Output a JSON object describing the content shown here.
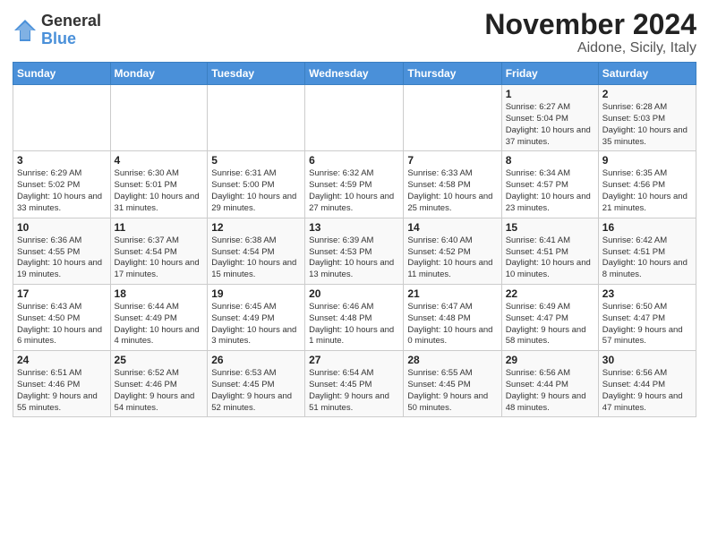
{
  "header": {
    "logo_general": "General",
    "logo_blue": "Blue",
    "title": "November 2024",
    "subtitle": "Aidone, Sicily, Italy"
  },
  "days_of_week": [
    "Sunday",
    "Monday",
    "Tuesday",
    "Wednesday",
    "Thursday",
    "Friday",
    "Saturday"
  ],
  "weeks": [
    [
      {
        "day": "",
        "info": ""
      },
      {
        "day": "",
        "info": ""
      },
      {
        "day": "",
        "info": ""
      },
      {
        "day": "",
        "info": ""
      },
      {
        "day": "",
        "info": ""
      },
      {
        "day": "1",
        "info": "Sunrise: 6:27 AM\nSunset: 5:04 PM\nDaylight: 10 hours and 37 minutes."
      },
      {
        "day": "2",
        "info": "Sunrise: 6:28 AM\nSunset: 5:03 PM\nDaylight: 10 hours and 35 minutes."
      }
    ],
    [
      {
        "day": "3",
        "info": "Sunrise: 6:29 AM\nSunset: 5:02 PM\nDaylight: 10 hours and 33 minutes."
      },
      {
        "day": "4",
        "info": "Sunrise: 6:30 AM\nSunset: 5:01 PM\nDaylight: 10 hours and 31 minutes."
      },
      {
        "day": "5",
        "info": "Sunrise: 6:31 AM\nSunset: 5:00 PM\nDaylight: 10 hours and 29 minutes."
      },
      {
        "day": "6",
        "info": "Sunrise: 6:32 AM\nSunset: 4:59 PM\nDaylight: 10 hours and 27 minutes."
      },
      {
        "day": "7",
        "info": "Sunrise: 6:33 AM\nSunset: 4:58 PM\nDaylight: 10 hours and 25 minutes."
      },
      {
        "day": "8",
        "info": "Sunrise: 6:34 AM\nSunset: 4:57 PM\nDaylight: 10 hours and 23 minutes."
      },
      {
        "day": "9",
        "info": "Sunrise: 6:35 AM\nSunset: 4:56 PM\nDaylight: 10 hours and 21 minutes."
      }
    ],
    [
      {
        "day": "10",
        "info": "Sunrise: 6:36 AM\nSunset: 4:55 PM\nDaylight: 10 hours and 19 minutes."
      },
      {
        "day": "11",
        "info": "Sunrise: 6:37 AM\nSunset: 4:54 PM\nDaylight: 10 hours and 17 minutes."
      },
      {
        "day": "12",
        "info": "Sunrise: 6:38 AM\nSunset: 4:54 PM\nDaylight: 10 hours and 15 minutes."
      },
      {
        "day": "13",
        "info": "Sunrise: 6:39 AM\nSunset: 4:53 PM\nDaylight: 10 hours and 13 minutes."
      },
      {
        "day": "14",
        "info": "Sunrise: 6:40 AM\nSunset: 4:52 PM\nDaylight: 10 hours and 11 minutes."
      },
      {
        "day": "15",
        "info": "Sunrise: 6:41 AM\nSunset: 4:51 PM\nDaylight: 10 hours and 10 minutes."
      },
      {
        "day": "16",
        "info": "Sunrise: 6:42 AM\nSunset: 4:51 PM\nDaylight: 10 hours and 8 minutes."
      }
    ],
    [
      {
        "day": "17",
        "info": "Sunrise: 6:43 AM\nSunset: 4:50 PM\nDaylight: 10 hours and 6 minutes."
      },
      {
        "day": "18",
        "info": "Sunrise: 6:44 AM\nSunset: 4:49 PM\nDaylight: 10 hours and 4 minutes."
      },
      {
        "day": "19",
        "info": "Sunrise: 6:45 AM\nSunset: 4:49 PM\nDaylight: 10 hours and 3 minutes."
      },
      {
        "day": "20",
        "info": "Sunrise: 6:46 AM\nSunset: 4:48 PM\nDaylight: 10 hours and 1 minute."
      },
      {
        "day": "21",
        "info": "Sunrise: 6:47 AM\nSunset: 4:48 PM\nDaylight: 10 hours and 0 minutes."
      },
      {
        "day": "22",
        "info": "Sunrise: 6:49 AM\nSunset: 4:47 PM\nDaylight: 9 hours and 58 minutes."
      },
      {
        "day": "23",
        "info": "Sunrise: 6:50 AM\nSunset: 4:47 PM\nDaylight: 9 hours and 57 minutes."
      }
    ],
    [
      {
        "day": "24",
        "info": "Sunrise: 6:51 AM\nSunset: 4:46 PM\nDaylight: 9 hours and 55 minutes."
      },
      {
        "day": "25",
        "info": "Sunrise: 6:52 AM\nSunset: 4:46 PM\nDaylight: 9 hours and 54 minutes."
      },
      {
        "day": "26",
        "info": "Sunrise: 6:53 AM\nSunset: 4:45 PM\nDaylight: 9 hours and 52 minutes."
      },
      {
        "day": "27",
        "info": "Sunrise: 6:54 AM\nSunset: 4:45 PM\nDaylight: 9 hours and 51 minutes."
      },
      {
        "day": "28",
        "info": "Sunrise: 6:55 AM\nSunset: 4:45 PM\nDaylight: 9 hours and 50 minutes."
      },
      {
        "day": "29",
        "info": "Sunrise: 6:56 AM\nSunset: 4:44 PM\nDaylight: 9 hours and 48 minutes."
      },
      {
        "day": "30",
        "info": "Sunrise: 6:56 AM\nSunset: 4:44 PM\nDaylight: 9 hours and 47 minutes."
      }
    ]
  ]
}
